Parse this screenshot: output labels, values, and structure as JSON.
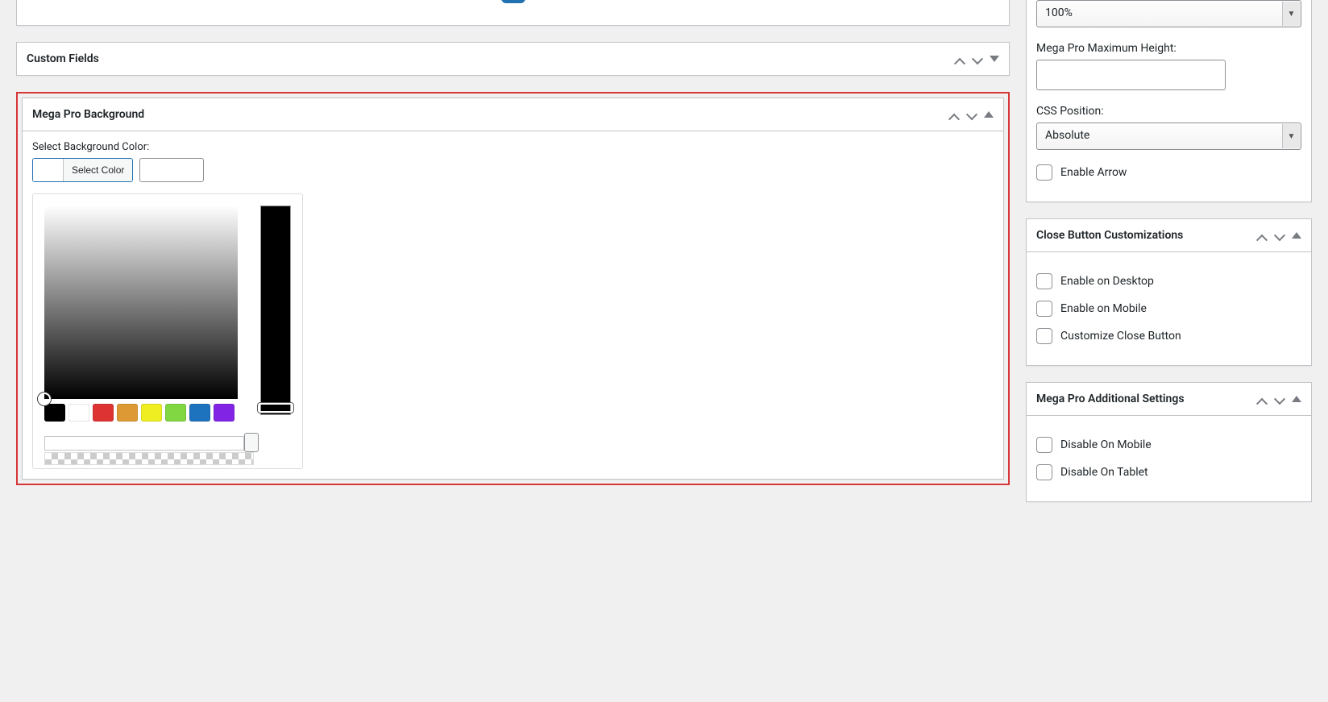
{
  "main": {
    "custom_fields": {
      "title": "Custom Fields"
    },
    "mega_pro_bg": {
      "title": "Mega Pro Background",
      "select_label": "Select Background Color:",
      "select_btn": "Select Color",
      "hex_value": "",
      "palette": [
        "#000000",
        "#ffffff",
        "#dd3333",
        "#dd9933",
        "#eeee22",
        "#81d742",
        "#1e73be",
        "#8224e3"
      ]
    }
  },
  "sidebar": {
    "width_select": "100%",
    "max_height_label": "Mega Pro Maximum Height:",
    "max_height_value": "",
    "css_position_label": "CSS Position:",
    "css_position_value": "Absolute",
    "enable_arrow": "Enable Arrow",
    "close_box": {
      "title": "Close Button Customizations",
      "opt1": "Enable on Desktop",
      "opt2": "Enable on Mobile",
      "opt3": "Customize Close Button"
    },
    "addl_box": {
      "title": "Mega Pro Additional Settings",
      "opt1": "Disable On Mobile",
      "opt2": "Disable On Tablet"
    }
  }
}
